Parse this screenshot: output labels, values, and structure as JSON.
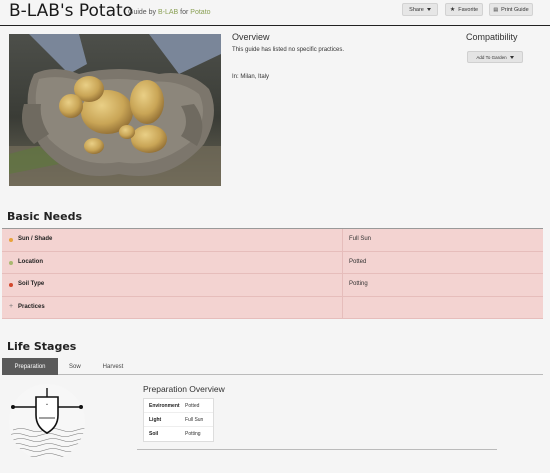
{
  "header": {
    "title": "B-LAB's Potato",
    "guide_by_prefix": "Guide by",
    "author": "B-LAB",
    "for_word": "for",
    "plant": "Potato",
    "share_label": "Share",
    "favorite_label": "Favorite",
    "print_label": "Print Guide"
  },
  "overview": {
    "title": "Overview",
    "text": "This guide has listed no specific practices.",
    "location": "In: Milan, Italy"
  },
  "compatibility": {
    "title": "Compatibility",
    "add_label": "Add To Garden"
  },
  "basic_needs": {
    "title": "Basic Needs",
    "rows": [
      {
        "label": "Sun / Shade",
        "value": "Full Sun",
        "dot_color": "#e8a33a"
      },
      {
        "label": "Location",
        "value": "Potted",
        "dot_color": "#a8b870"
      },
      {
        "label": "Soil Type",
        "value": "Potting",
        "dot_color": "#d2472c"
      },
      {
        "label": "Practices",
        "value": "",
        "dot_color": ""
      }
    ]
  },
  "life_stages": {
    "title": "Life Stages",
    "tabs": [
      "Preparation",
      "Sow",
      "Harvest"
    ],
    "active_tab": "Preparation"
  },
  "preparation": {
    "title": "Preparation Overview",
    "rows": [
      {
        "key": "Environment",
        "value": "Potted"
      },
      {
        "key": "Light",
        "value": "Full Sun"
      },
      {
        "key": "Soil",
        "value": "Potting"
      }
    ]
  }
}
